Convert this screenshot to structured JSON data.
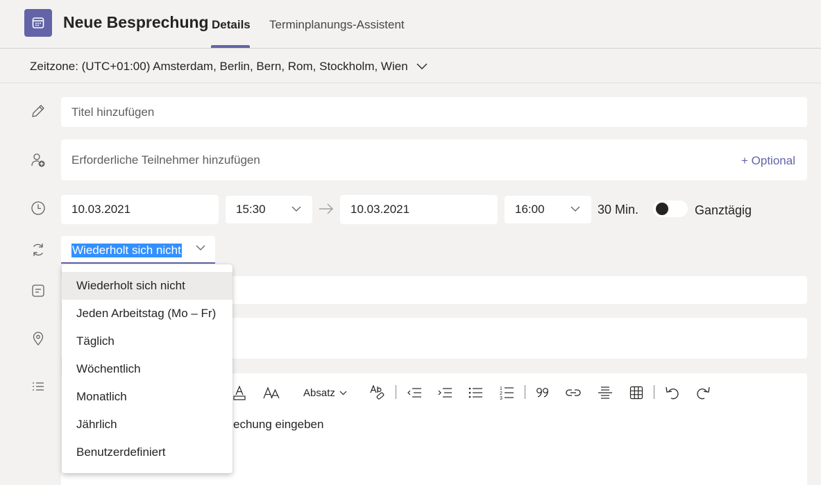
{
  "header": {
    "title": "Neue Besprechung",
    "tabs": [
      {
        "label": "Details",
        "active": true
      },
      {
        "label": "Terminplanungs-Assistent",
        "active": false
      }
    ],
    "icon": "calendar-icon",
    "accent": "#6264a7"
  },
  "timezone": {
    "label": "Zeitzone: (UTC+01:00) Amsterdam, Berlin, Bern, Rom, Stockholm, Wien"
  },
  "form": {
    "title_placeholder": "Titel hinzufügen",
    "attendees_placeholder": "Erforderliche Teilnehmer hinzufügen",
    "optional_label": "+ Optional",
    "start_date": "10.03.2021",
    "start_time": "15:30",
    "end_date": "10.03.2021",
    "end_time": "16:00",
    "duration": "30 Min.",
    "all_day_label": "Ganztägig",
    "all_day_on": false,
    "repeat_value": "Wiederholt sich nicht"
  },
  "repeat_options": [
    "Wiederholt sich nicht",
    "Jeden Arbeitstag (Mo – Fr)",
    "Täglich",
    "Wöchentlich",
    "Monatlich",
    "Jährlich",
    "Benutzerdefiniert"
  ],
  "editor": {
    "paragraph_label": "Absatz",
    "placeholder_visible": "echung eingeben"
  }
}
